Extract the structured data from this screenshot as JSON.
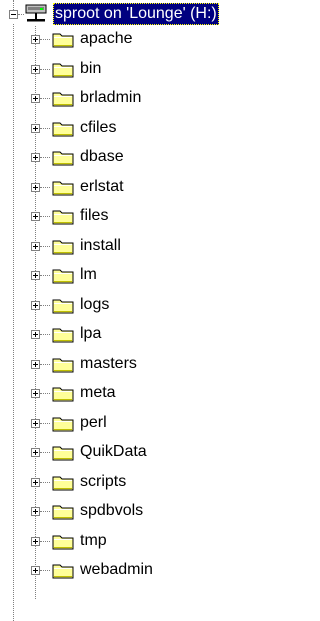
{
  "tree": {
    "root": {
      "label": "sproot on 'Lounge' (H:)",
      "icon": "network-drive-icon",
      "expanded": true,
      "selected": true
    },
    "folders": [
      {
        "label": "apache",
        "icon": "folder-icon",
        "expanded": false
      },
      {
        "label": "bin",
        "icon": "folder-icon",
        "expanded": false
      },
      {
        "label": "brladmin",
        "icon": "folder-icon",
        "expanded": false
      },
      {
        "label": "cfiles",
        "icon": "folder-icon",
        "expanded": false
      },
      {
        "label": "dbase",
        "icon": "folder-icon",
        "expanded": false
      },
      {
        "label": "erlstat",
        "icon": "folder-icon",
        "expanded": false
      },
      {
        "label": "files",
        "icon": "folder-icon",
        "expanded": false
      },
      {
        "label": "install",
        "icon": "folder-icon",
        "expanded": false
      },
      {
        "label": "lm",
        "icon": "folder-icon",
        "expanded": false
      },
      {
        "label": "logs",
        "icon": "folder-icon",
        "expanded": false
      },
      {
        "label": "lpa",
        "icon": "folder-icon",
        "expanded": false
      },
      {
        "label": "masters",
        "icon": "folder-icon",
        "expanded": false
      },
      {
        "label": "meta",
        "icon": "folder-icon",
        "expanded": false
      },
      {
        "label": "perl",
        "icon": "folder-icon",
        "expanded": false
      },
      {
        "label": "QuikData",
        "icon": "folder-icon",
        "expanded": false
      },
      {
        "label": "scripts",
        "icon": "folder-icon",
        "expanded": false
      },
      {
        "label": "spdbvols",
        "icon": "folder-icon",
        "expanded": false
      },
      {
        "label": "tmp",
        "icon": "folder-icon",
        "expanded": false
      },
      {
        "label": "webadmin",
        "icon": "folder-icon",
        "expanded": false
      }
    ]
  },
  "colors": {
    "selection_bg": "#000080",
    "selection_text": "#ffffff",
    "folder_fill": "#ffff99",
    "folder_shade": "#c0c000",
    "tree_line": "#808080"
  }
}
